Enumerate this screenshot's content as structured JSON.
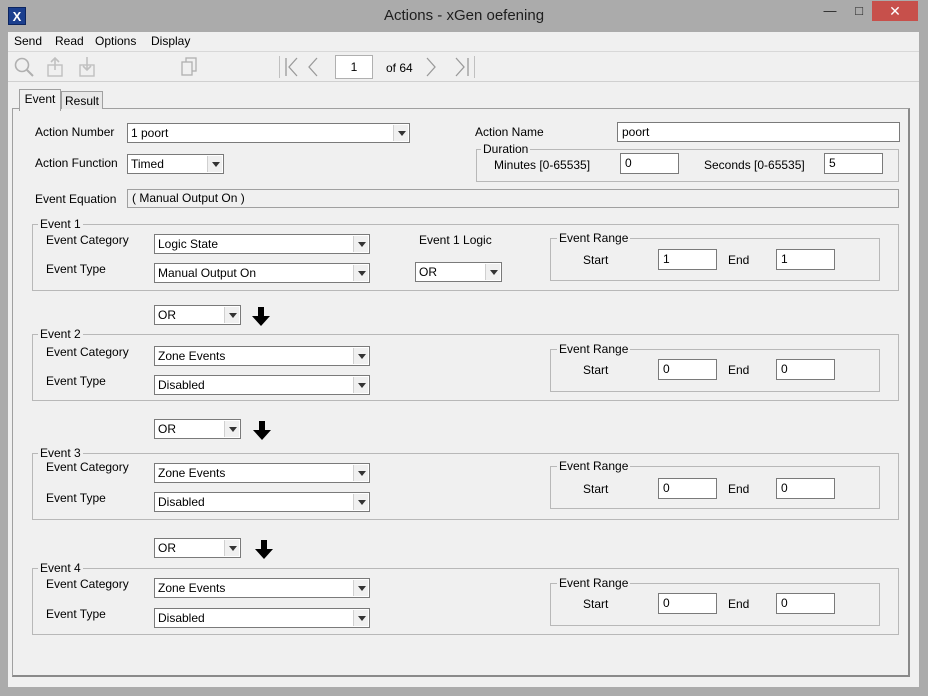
{
  "window": {
    "title": "Actions - xGen oefening",
    "icon_letter": "X",
    "minimize": "—",
    "maximize": "□",
    "close": "✕"
  },
  "menu": [
    "Send",
    "Read",
    "Options",
    "Display"
  ],
  "toolbar": {
    "page_value": "1",
    "page_of": "of 64"
  },
  "tabs": [
    "Event",
    "Result"
  ],
  "form": {
    "action_number_label": "Action Number",
    "action_number_value": "1 poort",
    "action_function_label": "Action Function",
    "action_function_value": "Timed",
    "action_name_label": "Action Name",
    "action_name_value": "poort",
    "duration_title": "Duration",
    "minutes_label": "Minutes  [0-65535]",
    "minutes_value": "0",
    "seconds_label": "Seconds  [0-65535]",
    "seconds_value": "5",
    "event_equation_label": "Event Equation",
    "event_equation_value": "(  Manual Output On  )"
  },
  "events": [
    {
      "title": "Event 1",
      "category_label": "Event Category",
      "category": "Logic State",
      "type_label": "Event Type",
      "type": "Manual Output On",
      "logic_label": "Event 1 Logic",
      "logic": "OR",
      "range_title": "Event Range",
      "start_label": "Start",
      "start": "1",
      "end_label": "End",
      "end": "1"
    },
    {
      "title": "Event 2",
      "category_label": "Event Category",
      "category": "Zone Events",
      "type_label": "Event Type",
      "type": "Disabled",
      "range_title": "Event Range",
      "start_label": "Start",
      "start": "0",
      "end_label": "End",
      "end": "0"
    },
    {
      "title": "Event 3",
      "category_label": "Event Category",
      "category": "Zone Events",
      "type_label": "Event Type",
      "type": "Disabled",
      "range_title": "Event Range",
      "start_label": "Start",
      "start": "0",
      "end_label": "End",
      "end": "0"
    },
    {
      "title": "Event 4",
      "category_label": "Event Category",
      "category": "Zone Events",
      "type_label": "Event Type",
      "type": "Disabled",
      "range_title": "Event Range",
      "start_label": "Start",
      "start": "0",
      "end_label": "End",
      "end": "0"
    }
  ],
  "connectors": [
    "OR",
    "OR",
    "OR"
  ],
  "colors": {
    "close": "#c7504b",
    "titlebar": "#ababab",
    "panel": "#f0f0f0",
    "app_icon": "#1b3f8e"
  }
}
